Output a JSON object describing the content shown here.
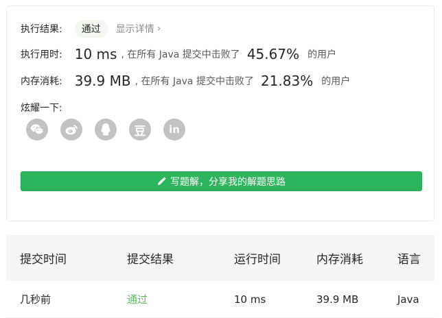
{
  "result": {
    "label": "执行结果:",
    "status": "通过",
    "detail_link": "显示详情",
    "chevron": "›"
  },
  "runtime": {
    "label": "执行用时:",
    "value": "10 ms",
    "middle": ", 在所有 Java 提交中击败了",
    "percent": "45.67%",
    "tail": "的用户"
  },
  "memory": {
    "label": "内存消耗:",
    "value": "39.9 MB",
    "middle": ", 在所有 Java 提交中击败了",
    "percent": "21.83%",
    "tail": "的用户"
  },
  "share": {
    "label": "炫耀一下:",
    "icons": [
      "wechat-icon",
      "weibo-icon",
      "qq-icon",
      "douban-icon",
      "linkedin-icon"
    ],
    "douban_glyph": "豆",
    "linkedin_glyph": "in"
  },
  "write_button": {
    "label": "写题解，分享我的解题思路",
    "color": "#2db55d"
  },
  "table": {
    "headers": [
      "提交时间",
      "提交结果",
      "运行时间",
      "内存消耗",
      "语言"
    ],
    "rows": [
      {
        "time": "几秒前",
        "result": "通过",
        "runtime": "10 ms",
        "memory": "39.9 MB",
        "language": "Java"
      }
    ]
  }
}
